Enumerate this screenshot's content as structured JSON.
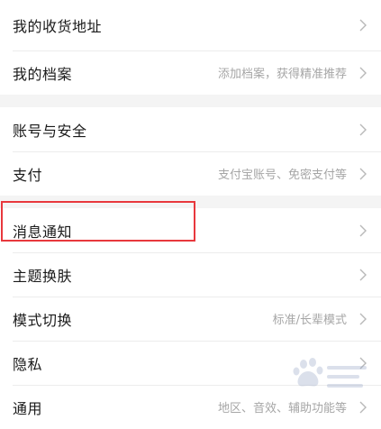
{
  "settings": {
    "group1": [
      {
        "label": "我的收货地址",
        "hint": ""
      },
      {
        "label": "我的档案",
        "hint": "添加档案，获得精准推荐"
      }
    ],
    "group2": [
      {
        "label": "账号与安全",
        "hint": ""
      },
      {
        "label": "支付",
        "hint": "支付宝账号、免密支付等"
      }
    ],
    "group3": [
      {
        "label": "消息通知",
        "hint": ""
      },
      {
        "label": "主题换肤",
        "hint": ""
      },
      {
        "label": "模式切换",
        "hint": "标准/长辈模式"
      },
      {
        "label": "隐私",
        "hint": ""
      },
      {
        "label": "通用",
        "hint": "地区、音效、辅助功能等"
      }
    ]
  },
  "highlight_color": "#e8383d",
  "icons": {
    "row_chevron": "chevron-right-icon",
    "watermark": "baidu-paw-watermark-icon"
  }
}
